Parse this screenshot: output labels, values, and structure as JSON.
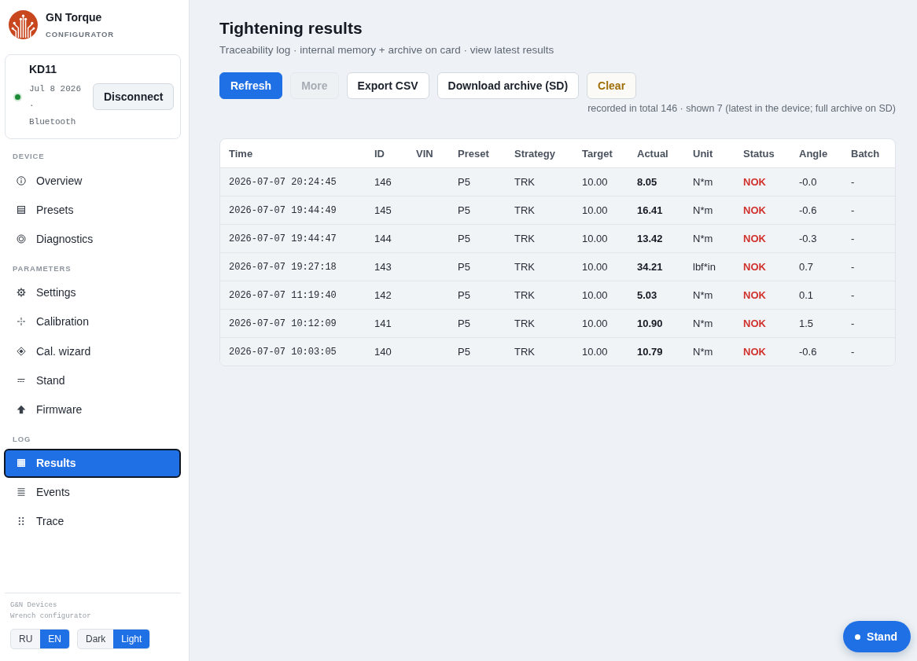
{
  "brand": {
    "title": "GN Torque",
    "subtitle": "CONFIGURATOR"
  },
  "device": {
    "name": "KD11",
    "connected": true,
    "info": "Jul 8 2026 · Bluetooth",
    "button": "Disconnect"
  },
  "sidebar": {
    "sections": [
      {
        "heading": "DEVICE",
        "items": [
          {
            "label": "Overview",
            "selected": false
          },
          {
            "label": "Presets",
            "selected": false
          },
          {
            "label": "Diagnostics",
            "selected": false
          }
        ]
      },
      {
        "heading": "PARAMETERS",
        "items": [
          {
            "label": "Settings",
            "selected": false
          },
          {
            "label": "Calibration",
            "selected": false
          },
          {
            "label": "Cal. wizard",
            "selected": false
          },
          {
            "label": "Stand",
            "selected": false
          },
          {
            "label": "Firmware",
            "selected": false
          }
        ]
      },
      {
        "heading": "LOG",
        "items": [
          {
            "label": "Results",
            "selected": true
          },
          {
            "label": "Events",
            "selected": false
          },
          {
            "label": "Trace",
            "selected": false
          }
        ]
      }
    ]
  },
  "footer": {
    "company": "G&N Devices",
    "product": "Wrench configurator",
    "language": [
      {
        "label": "RU",
        "selected": false
      },
      {
        "label": "EN",
        "selected": true
      }
    ],
    "theme": [
      {
        "label": "Dark",
        "selected": false
      },
      {
        "label": "Light",
        "selected": true
      }
    ]
  },
  "page": {
    "title": "Tightening results",
    "subtitle": "Traceability log · internal memory + archive on card · view latest results"
  },
  "toolbar": {
    "buttons": [
      {
        "label": "Refresh",
        "kind": "primary",
        "disabled": false
      },
      {
        "label": "More",
        "kind": "secondary",
        "disabled": true
      },
      {
        "label": "Export CSV",
        "kind": "secondary",
        "disabled": false
      },
      {
        "label": "Download archive (SD)",
        "kind": "secondary",
        "disabled": false
      },
      {
        "label": "Clear",
        "kind": "warning",
        "disabled": false
      }
    ],
    "summary": "recorded in total 146 · shown 7 (latest in the device; full archive on SD)"
  },
  "table": {
    "columns": [
      "Time",
      "ID",
      "VIN",
      "Preset",
      "Strategy",
      "Target",
      "Actual",
      "Unit",
      "Status",
      "Angle",
      "Batch"
    ],
    "rows": [
      {
        "time": "2026-07-07 20:24:45",
        "id": "146",
        "preset": "P5",
        "strategy": "TRK",
        "target": "10.00",
        "actual": "8.05",
        "unit": "N*m",
        "status": "NOK",
        "ok": false,
        "angle": "-0.0",
        "batch": "-"
      },
      {
        "time": "2026-07-07 19:44:49",
        "id": "145",
        "preset": "P5",
        "strategy": "TRK",
        "target": "10.00",
        "actual": "16.41",
        "unit": "N*m",
        "status": "NOK",
        "ok": false,
        "angle": "-0.6",
        "batch": "-"
      },
      {
        "time": "2026-07-07 19:44:47",
        "id": "144",
        "preset": "P5",
        "strategy": "TRK",
        "target": "10.00",
        "actual": "13.42",
        "unit": "N*m",
        "status": "NOK",
        "ok": false,
        "angle": "-0.3",
        "batch": "-"
      },
      {
        "time": "2026-07-07 19:27:18",
        "id": "143",
        "preset": "P5",
        "strategy": "TRK",
        "target": "10.00",
        "actual": "34.21",
        "unit": "lbf*in",
        "status": "NOK",
        "ok": false,
        "angle": "0.7",
        "batch": "-"
      },
      {
        "time": "2026-07-07 11:19:40",
        "id": "142",
        "preset": "P5",
        "strategy": "TRK",
        "target": "10.00",
        "actual": "5.03",
        "unit": "N*m",
        "status": "NOK",
        "ok": false,
        "angle": "0.1",
        "batch": "-"
      },
      {
        "time": "2026-07-07 10:12:09",
        "id": "141",
        "preset": "P5",
        "strategy": "TRK",
        "target": "10.00",
        "actual": "10.90",
        "unit": "N*m",
        "status": "NOK",
        "ok": false,
        "angle": "1.5",
        "batch": "-"
      },
      {
        "time": "2026-07-07 10:03:05",
        "id": "140",
        "preset": "P5",
        "strategy": "TRK",
        "target": "10.00",
        "actual": "10.79",
        "unit": "N*m",
        "status": "NOK",
        "ok": false,
        "angle": "-0.6",
        "batch": "-"
      }
    ]
  },
  "floating_button": {
    "label": "Stand"
  }
}
